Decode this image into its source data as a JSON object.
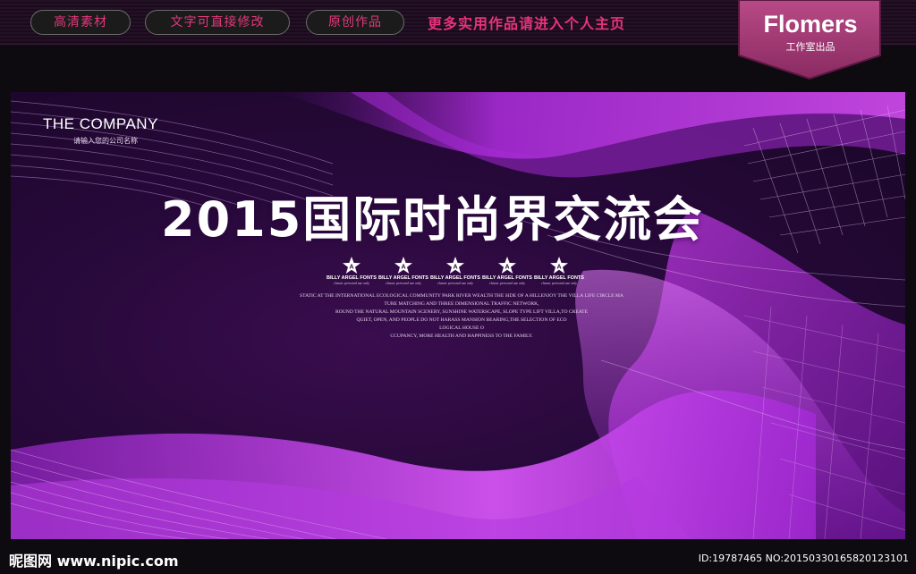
{
  "topbar": {
    "tags": [
      "高清素材",
      "文字可直接修改",
      "原创作品"
    ],
    "promo": "更多实用作品请进入个人主页",
    "brand_name": "Flomers",
    "brand_sub": "工作室出品"
  },
  "banner": {
    "company": "THE COMPANY",
    "company_sub": "请输入您的公司名称",
    "headline": "2015国际时尚界交流会",
    "star_badges": [
      {
        "letter": "A",
        "caption": "BILLY ARGEL FONTS",
        "tag": "classic personal use only"
      },
      {
        "letter": "A",
        "caption": "BILLY ARGEL FONTS",
        "tag": "classic personal use only"
      },
      {
        "letter": "A",
        "caption": "BILLY ARGEL FONTS",
        "tag": "classic personal use only"
      },
      {
        "letter": "A",
        "caption": "BILLY ARGEL FONTS",
        "tag": "classic personal use only"
      },
      {
        "letter": "A",
        "caption": "BILLY ARGEL FONTS",
        "tag": "classic personal use only"
      }
    ],
    "body_lines": [
      "STATIC AT THE INTERNATIONAL ECOLOGICAL COMMUNITY PARK RIVER WEALTH THE SIDE OF A HILLENJOY THE VILLA LIFE CIRCLE MA",
      "TURE MATCHING AND THREE DIMENSIONAL TRAFFIC NETWORK,",
      "ROUND THE NATURAL MOUNTAIN SCENERY, SUNSHINE WATERSCAPE, SLOPE TYPE LIFT VILLA,TO CREATE",
      "QUIET, OPEN, AND PEOPLE DO NOT HARASS MANSION BEARING,THE SELECTION OF ECO",
      "LOGICAL HOUSE O",
      "CCUPANCY, MORE HEALTH AND HAPPINESS TO THE FAMILY."
    ]
  },
  "footer": {
    "site": "昵图网 www.nipic.com",
    "id_text": "ID:19787465 NO:20150330165820123101"
  },
  "colors": {
    "accent_pink": "#e0397e",
    "badge_purple": "#a63a7e",
    "wave_magenta": "#c63be8",
    "background": "#0d0a10"
  }
}
